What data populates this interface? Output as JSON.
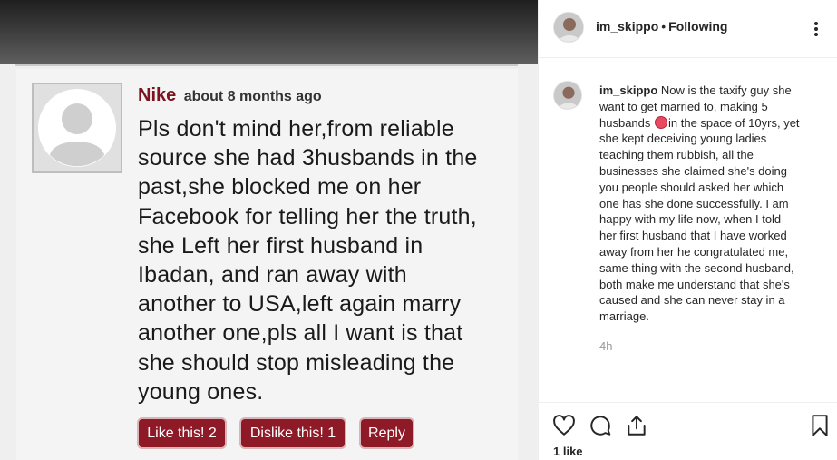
{
  "comment": {
    "author": "Nike",
    "time": "about 8 months ago",
    "text_lines": [
      "Pls don't mind her,from reliable",
      "source she had 3husbands in the",
      "past,she blocked me on her",
      "Facebook for telling her the truth,",
      "she Left her first husband in",
      "Ibadan, and ran away with",
      "another to USA,left again marry",
      "another one,pls all I want is that",
      "she should stop misleading the",
      "young ones."
    ],
    "like_label": "Like this! 2",
    "dislike_label": "Dislike this! 1",
    "reply_label": "Reply"
  },
  "header": {
    "username": "im_skippo",
    "separator": "•",
    "follow_status": "Following",
    "more_icon": "more-options-icon"
  },
  "caption": {
    "username": "im_skippo",
    "lines": [
      "Now is the taxify guy she",
      "want to get married to, making 5",
      "in the space of 10yrs, yet",
      "she kept deceiving young ladies",
      "teaching them rubbish, all the",
      "businesses she claimed she's doing",
      "you people should asked her which",
      "one has she done successfully. I am",
      "happy with my life now, when I told",
      "her first husband that I have worked",
      "away from her he congratulated me,",
      "same thing with the second husband,",
      "both make me understand that she's",
      "caused and she can never stay in a",
      "marriage."
    ],
    "line3_prefix": "husbands",
    "emoji_icon": "face-emoji-icon",
    "time": "4h"
  },
  "actions": {
    "icons": [
      "heart-icon",
      "comment-icon",
      "share-icon",
      "bookmark-icon"
    ],
    "likes": "1 like"
  },
  "colors": {
    "button_red": "#8e1a28",
    "author_red": "#7c1420",
    "text_dark": "#262626",
    "muted": "#999999"
  }
}
